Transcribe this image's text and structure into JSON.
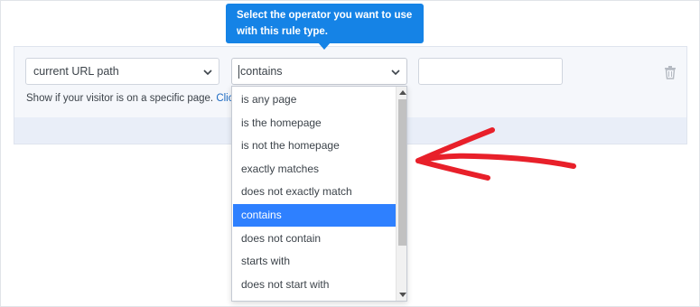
{
  "rule": {
    "field_select": {
      "value": "current URL path"
    },
    "operator_select": {
      "value": "contains"
    },
    "value_input": {
      "value": ""
    },
    "help": {
      "text": "Show if your visitor is on a specific page.",
      "link_text": "Click her"
    }
  },
  "tooltip": {
    "line1": "Select the operator you want to use",
    "line2": "with this rule type."
  },
  "operator_options": [
    {
      "label": "is any page",
      "selected": false
    },
    {
      "label": "is the homepage",
      "selected": false
    },
    {
      "label": "is not the homepage",
      "selected": false
    },
    {
      "label": "exactly matches",
      "selected": false
    },
    {
      "label": "does not exactly match",
      "selected": false
    },
    {
      "label": "contains",
      "selected": true
    },
    {
      "label": "does not contain",
      "selected": false
    },
    {
      "label": "starts with",
      "selected": false
    },
    {
      "label": "does not start with",
      "selected": false
    }
  ],
  "icons": {
    "field_chevron": "chevron-down-icon",
    "operator_chevron": "chevron-down-icon",
    "delete": "trash-icon",
    "annotation": "red-arrow-annotation"
  },
  "colors": {
    "tooltip_bg": "#1583e6",
    "selected_option_bg": "#2e80ff",
    "link": "#1c6ac2",
    "annotation": "#e8202a"
  }
}
